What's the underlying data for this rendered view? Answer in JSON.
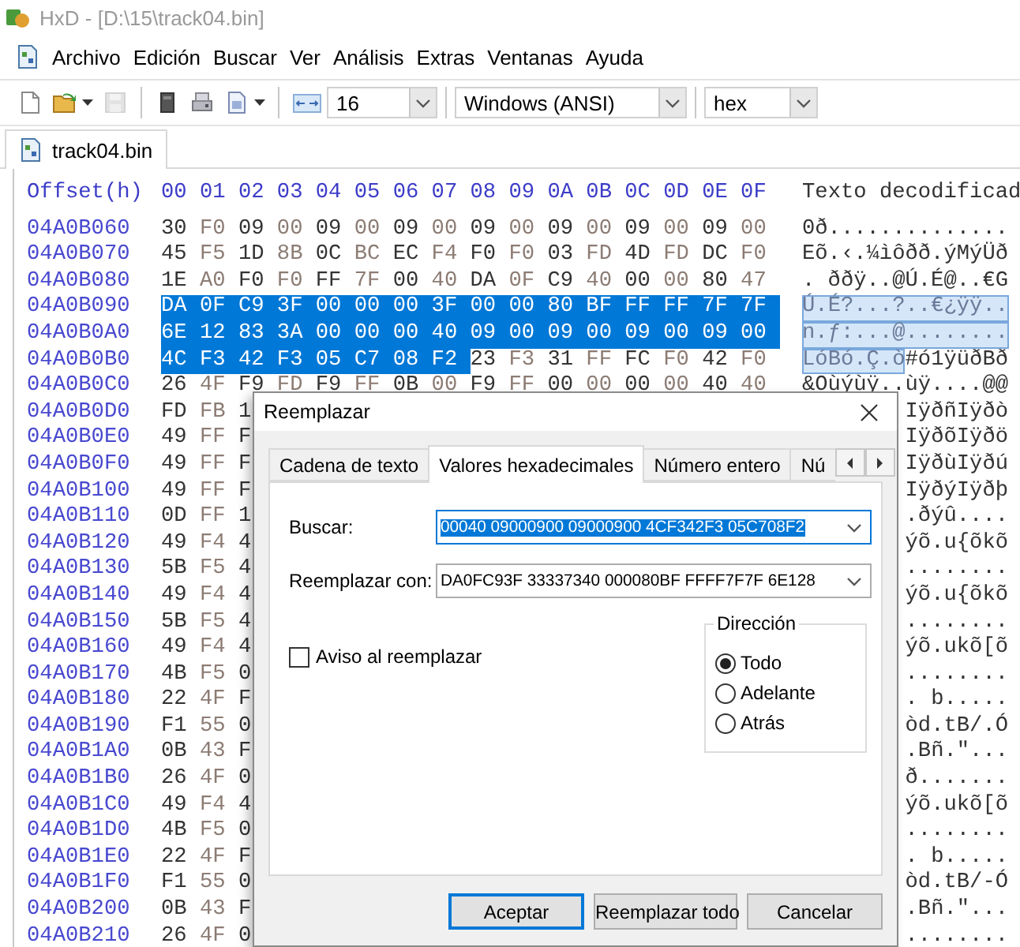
{
  "window": {
    "title": "HxD - [D:\\15\\track04.bin]",
    "active": false
  },
  "menu": [
    "Archivo",
    "Edición",
    "Buscar",
    "Ver",
    "Análisis",
    "Extras",
    "Ventanas",
    "Ayuda"
  ],
  "toolbar": [
    {
      "kind": "button",
      "dropdown": false,
      "disabled": false
    },
    {
      "kind": "button",
      "dropdown": true,
      "disabled": false
    },
    {
      "kind": "button",
      "dropdown": false,
      "disabled": true
    },
    {
      "kind": "separator"
    },
    {
      "kind": "button",
      "dropdown": false,
      "disabled": false
    },
    {
      "kind": "button",
      "dropdown": false,
      "disabled": false
    },
    {
      "kind": "button",
      "dropdown": true,
      "disabled": false
    },
    {
      "kind": "separator"
    },
    {
      "kind": "button",
      "dropdown": false,
      "disabled": false
    },
    {
      "kind": "combo",
      "value": "16"
    },
    {
      "kind": "separator"
    },
    {
      "kind": "combo",
      "value": "Windows (ANSI)"
    },
    {
      "kind": "separator"
    },
    {
      "kind": "combo",
      "value": "hex"
    }
  ],
  "document_tabs": [
    {
      "label": "track04.bin",
      "selected": true
    }
  ],
  "hex_view": {
    "header": {
      "offset": "Offset(h)",
      "columns": [
        "00",
        "01",
        "02",
        "03",
        "04",
        "05",
        "06",
        "07",
        "08",
        "09",
        "0A",
        "0B",
        "0C",
        "0D",
        "0E",
        "0F"
      ],
      "text": "Texto decodificad"
    },
    "rows": [
      {
        "offset": "04A0B060",
        "bytes": [
          "30",
          "F0",
          "09",
          "00",
          "09",
          "00",
          "09",
          "00",
          "09",
          "00",
          "09",
          "00",
          "09",
          "00",
          "09",
          "00"
        ],
        "text": "0ð.............."
      },
      {
        "offset": "04A0B070",
        "bytes": [
          "45",
          "F5",
          "1D",
          "8B",
          "0C",
          "BC",
          "EC",
          "F4",
          "F0",
          "F0",
          "03",
          "FD",
          "4D",
          "FD",
          "DC",
          "F0"
        ],
        "text": "Eõ.‹.¼ìôðð.ýMýÜð"
      },
      {
        "offset": "04A0B080",
        "bytes": [
          "1E",
          "A0",
          "F0",
          "F0",
          "FF",
          "7F",
          "00",
          "40",
          "DA",
          "0F",
          "C9",
          "40",
          "00",
          "00",
          "80",
          "47"
        ],
        "text": ". ððÿ..@Ú.É@..€G"
      },
      {
        "offset": "04A0B090",
        "selected_bytes": [
          "DA",
          "0F",
          "C9",
          "3F",
          "00",
          "00",
          "00",
          "3F",
          "00",
          "00",
          "80",
          "BF",
          "FF",
          "FF",
          "7F",
          "7F"
        ],
        "selected_text": "Ú.É?...?..€¿ÿÿ.."
      },
      {
        "offset": "04A0B0A0",
        "selected_bytes": [
          "6E",
          "12",
          "83",
          "3A",
          "00",
          "00",
          "00",
          "40",
          "09",
          "00",
          "09",
          "00",
          "09",
          "00",
          "09",
          "00"
        ],
        "selected_text": "n.ƒ:...@........"
      },
      {
        "offset": "04A0B0B0",
        "selected_bytes": [
          "4C",
          "F3",
          "42",
          "F3",
          "05",
          "C7",
          "08",
          "F2"
        ],
        "bytes": [
          "23",
          "F3",
          "31",
          "FF",
          "FC",
          "F0",
          "42",
          "F0"
        ],
        "selected_text": "LóBó.Ç.ò",
        "text": "#ó1ÿüðBð"
      },
      {
        "offset": "04A0B0C0",
        "bytes": [
          "26",
          "4F",
          "F9",
          "FD",
          "F9",
          "FF",
          "0B",
          "00",
          "F9",
          "FF",
          "00",
          "00",
          "00",
          "00",
          "40",
          "40"
        ],
        "text": "&Oùýùÿ..ùÿ....@@"
      },
      {
        "offset": "04A0B0D0",
        "bytes": [
          "FD",
          "FB",
          "1"
        ],
        "text": "IÿðñIÿðò"
      },
      {
        "offset": "04A0B0E0",
        "bytes": [
          "49",
          "FF",
          "F"
        ],
        "text": "IÿðõIÿðö"
      },
      {
        "offset": "04A0B0F0",
        "bytes": [
          "49",
          "FF",
          "F"
        ],
        "text": "IÿðùIÿðú"
      },
      {
        "offset": "04A0B100",
        "bytes": [
          "49",
          "FF",
          "F"
        ],
        "text": "IÿðýIÿðþ"
      },
      {
        "offset": "04A0B110",
        "bytes": [
          "0D",
          "FF",
          "1"
        ],
        "text": ".ðýû...."
      },
      {
        "offset": "04A0B120",
        "bytes": [
          "49",
          "F4",
          "4"
        ],
        "text": "ýõ.u{õkõ"
      },
      {
        "offset": "04A0B130",
        "bytes": [
          "5B",
          "F5",
          "4"
        ],
        "text": "........"
      },
      {
        "offset": "04A0B140",
        "bytes": [
          "49",
          "F4",
          "4"
        ],
        "text": "ýõ.u{õkõ"
      },
      {
        "offset": "04A0B150",
        "bytes": [
          "5B",
          "F5",
          "4"
        ],
        "text": "........"
      },
      {
        "offset": "04A0B160",
        "bytes": [
          "49",
          "F4",
          "4"
        ],
        "text": "ýõ.ukõ[õ"
      },
      {
        "offset": "04A0B170",
        "bytes": [
          "4B",
          "F5",
          "0"
        ],
        "text": "........"
      },
      {
        "offset": "04A0B180",
        "bytes": [
          "22",
          "4F",
          "F"
        ],
        "text": ". b....."
      },
      {
        "offset": "04A0B190",
        "bytes": [
          "F1",
          "55",
          "0"
        ],
        "text": "òd.tB/.Ó"
      },
      {
        "offset": "04A0B1A0",
        "bytes": [
          "0B",
          "43",
          "F"
        ],
        "text": ".Bñ.\"..."
      },
      {
        "offset": "04A0B1B0",
        "bytes": [
          "26",
          "4F",
          "0"
        ],
        "text": "ð......."
      },
      {
        "offset": "04A0B1C0",
        "bytes": [
          "49",
          "F4",
          "4"
        ],
        "text": "ýõ.ukõ[õ"
      },
      {
        "offset": "04A0B1D0",
        "bytes": [
          "4B",
          "F5",
          "0"
        ],
        "text": "........"
      },
      {
        "offset": "04A0B1E0",
        "bytes": [
          "22",
          "4F",
          "F"
        ],
        "text": ". b....."
      },
      {
        "offset": "04A0B1F0",
        "bytes": [
          "F1",
          "55",
          "0"
        ],
        "text": "òd.tB/-Ó"
      },
      {
        "offset": "04A0B200",
        "bytes": [
          "0B",
          "43",
          "F"
        ],
        "text": ".Bñ.\"..."
      },
      {
        "offset": "04A0B210",
        "bytes": [
          "26",
          "4F",
          "0"
        ],
        "text": "........"
      }
    ]
  },
  "dialog": {
    "title": "Reemplazar",
    "tabs": [
      {
        "label": "Cadena de texto",
        "selected": false
      },
      {
        "label": "Valores hexadecimales",
        "selected": true
      },
      {
        "label": "Número entero",
        "selected": false
      },
      {
        "label": "Nú",
        "selected": false
      }
    ],
    "fields": [
      {
        "label": "Buscar:",
        "value": "00040 09000900 09000900 4CF342F3 05C708F2",
        "text_selected": true
      },
      {
        "label": "Reemplazar con:",
        "value": "DA0FC93F 33337340 000080BF FFFF7F7F 6E128",
        "text_selected": false
      }
    ],
    "warn_checkbox": {
      "label": "Aviso al reemplazar",
      "checked": false
    },
    "direction": {
      "title": "Dirección",
      "options": [
        {
          "label": "Todo",
          "selected": true
        },
        {
          "label": "Adelante",
          "selected": false
        },
        {
          "label": "Atrás",
          "selected": false
        }
      ]
    },
    "buttons": [
      {
        "label": "Aceptar",
        "default": true
      },
      {
        "label": "Reemplazar todo",
        "default": false
      },
      {
        "label": "Cancelar",
        "default": false
      }
    ]
  }
}
